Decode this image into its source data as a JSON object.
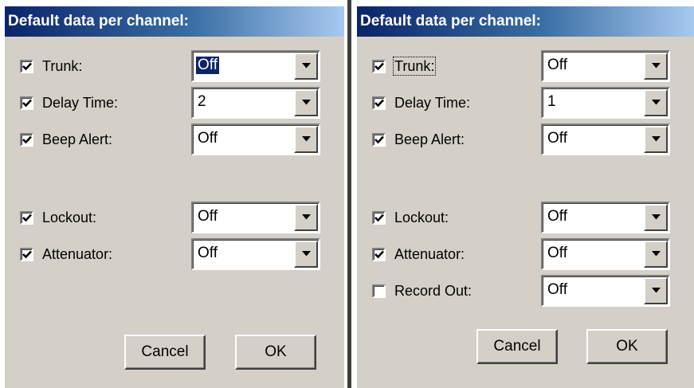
{
  "left_panel": {
    "title": "Default data per channel:",
    "rows": [
      {
        "label": "Trunk:",
        "checked": true,
        "value": "Off"
      },
      {
        "label": "Delay Time:",
        "checked": true,
        "value": "2"
      },
      {
        "label": "Beep Alert:",
        "checked": true,
        "value": "Off"
      },
      {
        "label": "Lockout:",
        "checked": true,
        "value": "Off"
      },
      {
        "label": "Attenuator:",
        "checked": true,
        "value": "Off"
      }
    ],
    "cancel_label": "Cancel",
    "ok_label": "OK"
  },
  "right_panel": {
    "title": "Default data per channel:",
    "rows": [
      {
        "label": "Trunk:",
        "checked": true,
        "value": "Off"
      },
      {
        "label": "Delay Time:",
        "checked": true,
        "value": "1"
      },
      {
        "label": "Beep Alert:",
        "checked": true,
        "value": "Off"
      },
      {
        "label": "Lockout:",
        "checked": true,
        "value": "Off"
      },
      {
        "label": "Attenuator:",
        "checked": true,
        "value": "Off"
      },
      {
        "label": "Record Out:",
        "checked": false,
        "value": "Off"
      }
    ],
    "cancel_label": "Cancel",
    "ok_label": "OK"
  },
  "colors": {
    "face": "#d4d0c8",
    "title_start": "#0a246a",
    "title_end": "#a6caf0",
    "selection": "#0a246a"
  },
  "icons": {
    "checkbox_mark": "checkmark-icon",
    "dropdown_arrow": "triangle-down-icon"
  }
}
